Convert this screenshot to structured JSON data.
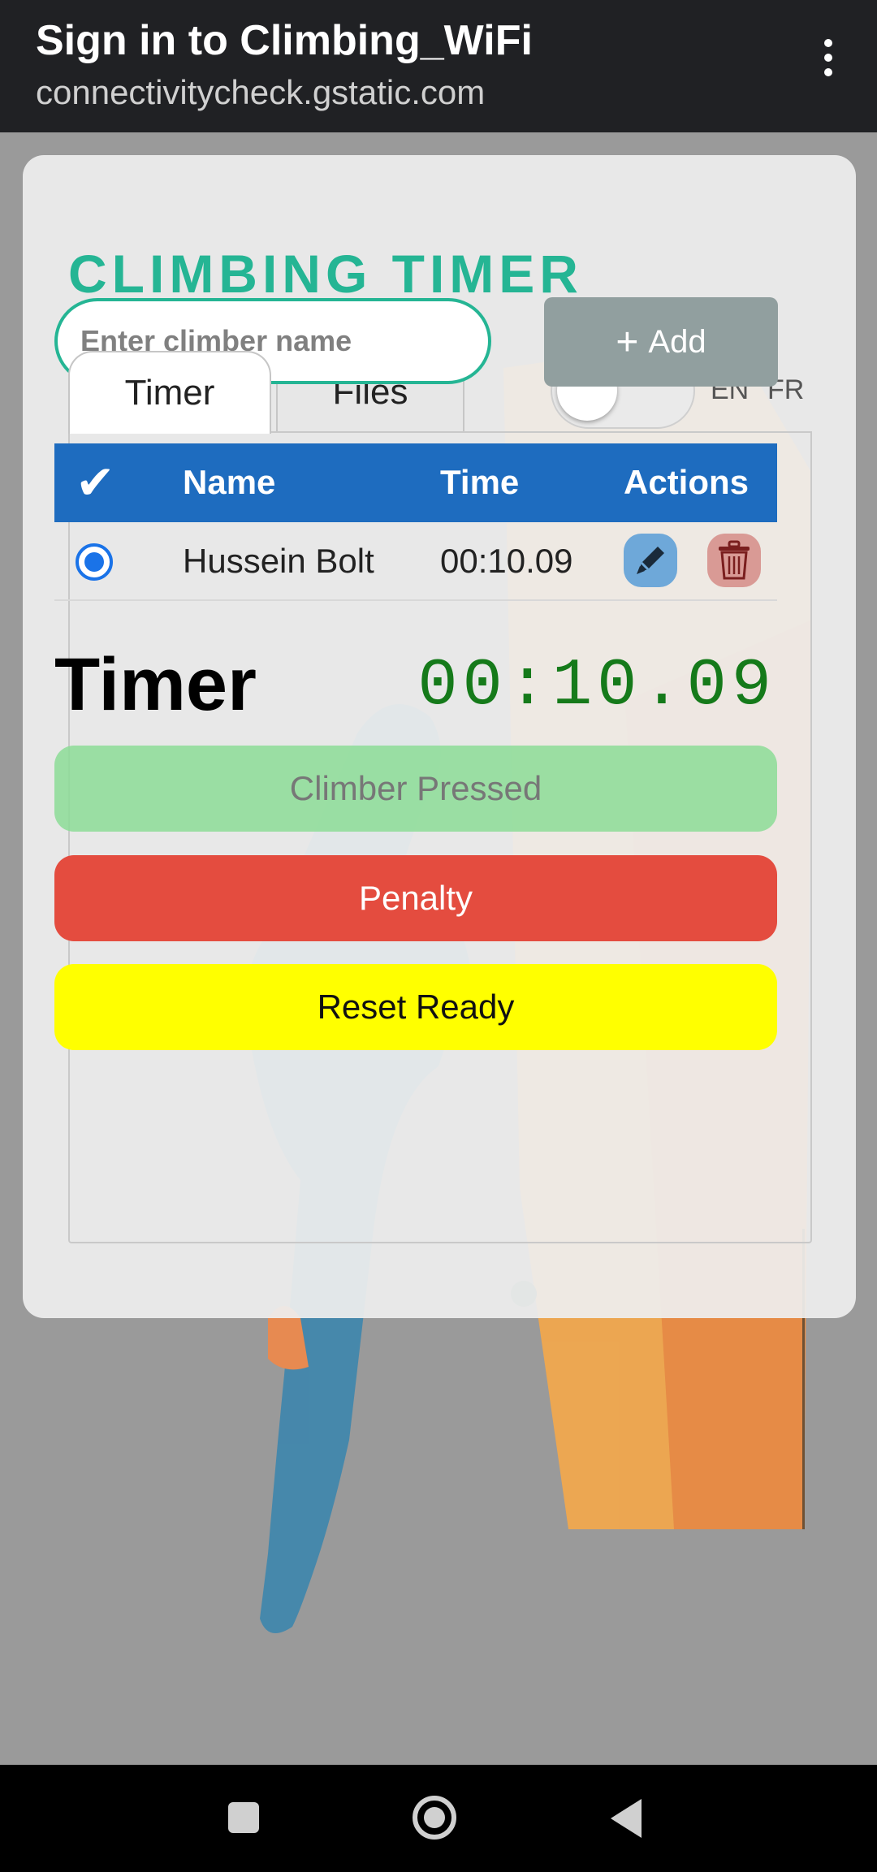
{
  "browser": {
    "title": "Sign in to Climbing_WiFi",
    "url": "connectivitycheck.gstatic.com",
    "menu_icon": "more-vert-icon"
  },
  "app": {
    "title": "CLIMBING TIMER",
    "accent_color": "#25b594",
    "tabs": [
      {
        "label": "Timer",
        "active": true
      },
      {
        "label": "Files",
        "active": false
      }
    ],
    "language_toggle": {
      "on": false,
      "left_label": "EN",
      "right_label": "FR"
    },
    "climber_input": {
      "placeholder": "Enter climber name",
      "value": ""
    },
    "add_button": {
      "icon": "plus-icon",
      "label": "Add"
    },
    "table": {
      "header_color": "#1e6cbf",
      "columns": {
        "check": "✔",
        "name": "Name",
        "time": "Time",
        "actions": "Actions"
      },
      "rows": [
        {
          "selected": true,
          "name": "Hussein Bolt",
          "time": "00:10.09",
          "actions": [
            "pencil-icon",
            "trash-icon"
          ]
        }
      ]
    },
    "timer": {
      "label": "Timer",
      "value": "00:10.09",
      "color": "#157a1a"
    },
    "buttons": {
      "climber_pressed": "Climber Pressed",
      "penalty": "Penalty",
      "reset_ready": "Reset Ready"
    }
  },
  "system_nav": {
    "icons": [
      "recents-square-icon",
      "home-circle-icon",
      "back-triangle-icon"
    ]
  }
}
